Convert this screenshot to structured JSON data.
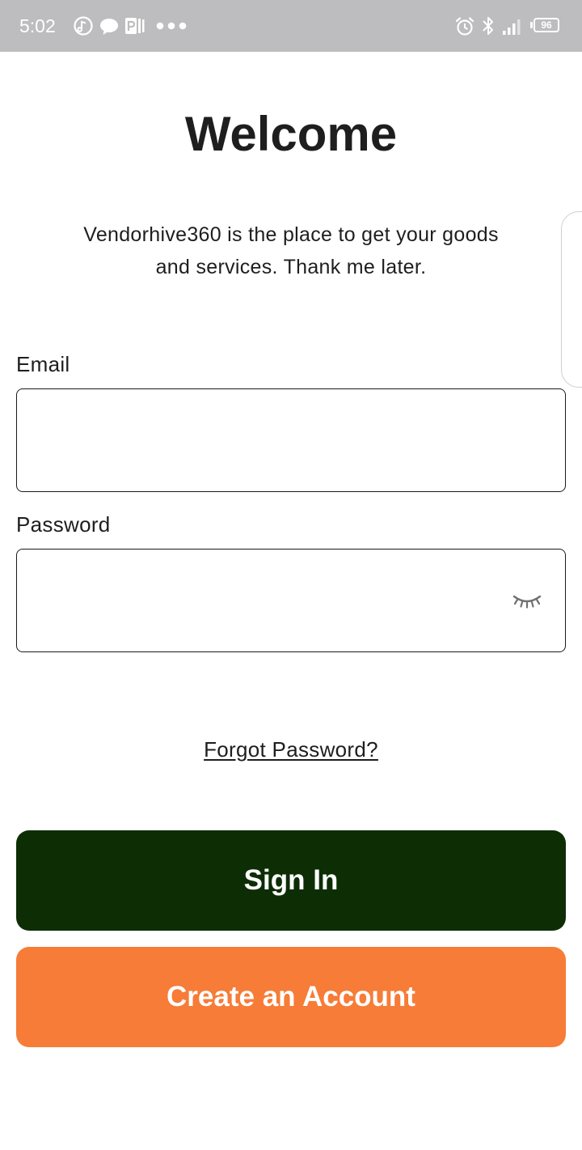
{
  "status_bar": {
    "time": "5:02",
    "battery": "96",
    "icons": [
      "music-icon",
      "chat-bubble-icon",
      "parking-app-icon",
      "more-dots-icon",
      "alarm-icon",
      "bluetooth-icon",
      "signal-icon",
      "battery-icon"
    ]
  },
  "welcome": {
    "title": "Welcome",
    "subtitle_line1": "Vendorhive360 is the place to get your goods",
    "subtitle_line2": "and services. Thank me later."
  },
  "form": {
    "email_label": "Email",
    "email_value": "",
    "password_label": "Password",
    "password_value": "",
    "forgot_label": "Forgot Password?"
  },
  "actions": {
    "sign_in_label": "Sign In",
    "create_account_label": "Create an Account"
  },
  "colors": {
    "status_bar_bg": "#bdbcbe",
    "primary_dark_green": "#0d2e05",
    "accent_orange": "#f67c37",
    "text": "#1e1e1e"
  }
}
